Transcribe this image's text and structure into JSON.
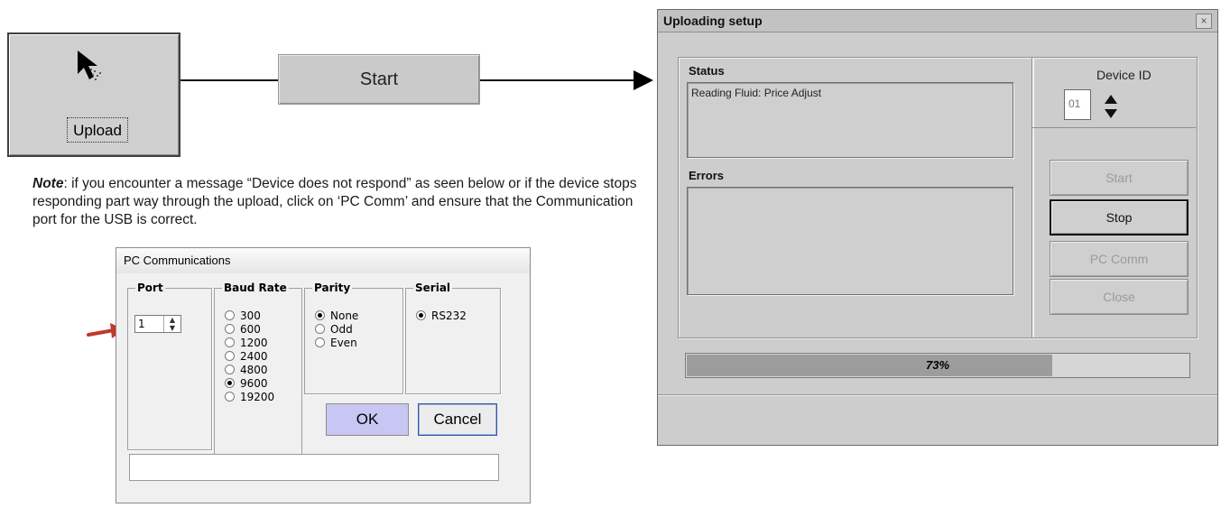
{
  "toolbar": {
    "upload_label": "Upload",
    "upload_icon": "cursor-arrow-icon",
    "start_label": "Start"
  },
  "note": {
    "lead": "Note",
    "text": ": if you encounter a message “Device does not respond” as seen below or if the device stops responding part way through the upload, click on ‘PC Comm’ and ensure that the Communication port for the USB is correct."
  },
  "pc_dialog": {
    "title": "PC Communications",
    "port": {
      "label": "Port",
      "value": "1"
    },
    "baud_rate": {
      "label": "Baud Rate",
      "options": [
        "300",
        "600",
        "1200",
        "2400",
        "4800",
        "9600",
        "19200"
      ],
      "selected": "9600"
    },
    "parity": {
      "label": "Parity",
      "options": [
        "None",
        "Odd",
        "Even"
      ],
      "selected": "None"
    },
    "serial": {
      "label": "Serial",
      "options": [
        "RS232"
      ],
      "selected": "RS232"
    },
    "ok_label": "OK",
    "cancel_label": "Cancel",
    "status_text": ""
  },
  "upload_dialog": {
    "title": "Uploading setup",
    "close_glyph": "×",
    "status_label": "Status",
    "status_text": "Reading Fluid: Price Adjust",
    "errors_label": "Errors",
    "errors_text": "",
    "device_id_label": "Device ID",
    "device_id_value": "01",
    "buttons": {
      "start": "Start",
      "stop": "Stop",
      "pc_comm": "PC Comm",
      "close": "Close"
    },
    "progress_percent": 73,
    "progress_label": "73%"
  },
  "colors": {
    "accent_arrow": "#c0392b",
    "ok_button": "#c8c6f2"
  }
}
